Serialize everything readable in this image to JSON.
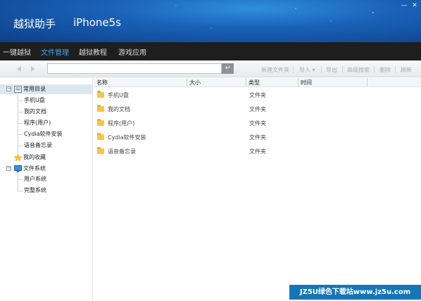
{
  "window": {
    "app_title": "越狱助手",
    "device_name": "iPhone5s",
    "min_glyph": "—",
    "close_glyph": "✕"
  },
  "nav": {
    "items": [
      {
        "label": "一键越狱",
        "active": false
      },
      {
        "label": "文件管理",
        "active": true
      },
      {
        "label": "越狱教程",
        "active": false
      },
      {
        "label": "游戏应用",
        "active": false
      }
    ]
  },
  "toolbar": {
    "address_value": "",
    "enter_glyph": "↵",
    "new_folder": "新建文件夹",
    "import": "导入",
    "import_arrow": "▾",
    "export": "导出",
    "advanced_search": "高级搜索",
    "delete": "删除",
    "refresh": "刷新"
  },
  "tree": {
    "nodes": [
      {
        "label": "常用目录",
        "expander": "−",
        "icon": "common-dir-icon"
      },
      {
        "label": "手机U盘"
      },
      {
        "label": "我的文档"
      },
      {
        "label": "程序(用户)"
      },
      {
        "label": "Cydia软件安装"
      },
      {
        "label": "语音备忘录"
      },
      {
        "label": "我的收藏",
        "icon": "star-icon"
      },
      {
        "label": "文件系统",
        "expander": "−",
        "icon": "computer-icon"
      },
      {
        "label": "用户系统"
      },
      {
        "label": "完整系统"
      }
    ]
  },
  "file_list": {
    "columns": {
      "name": "名称",
      "size": "大小",
      "type": "类型",
      "time": "时间"
    },
    "rows": [
      {
        "name": "手机U盘",
        "size": "",
        "type": "文件夹",
        "time": ""
      },
      {
        "name": "我的文档",
        "size": "",
        "type": "文件夹",
        "time": ""
      },
      {
        "name": "程序(用户)",
        "size": "",
        "type": "文件夹",
        "time": ""
      },
      {
        "name": "Cydia软件安装",
        "size": "",
        "type": "文件夹",
        "time": ""
      },
      {
        "name": "语音备忘录",
        "size": "",
        "type": "文件夹",
        "time": ""
      }
    ]
  },
  "watermark": {
    "text": "JZ5U绿色下载站www.jz5u.com"
  },
  "colors": {
    "accent": "#3ba4ff",
    "title_bar": "#1a62b8",
    "nav_bg": "#1e1e1e",
    "folder": "#f4c64d"
  }
}
